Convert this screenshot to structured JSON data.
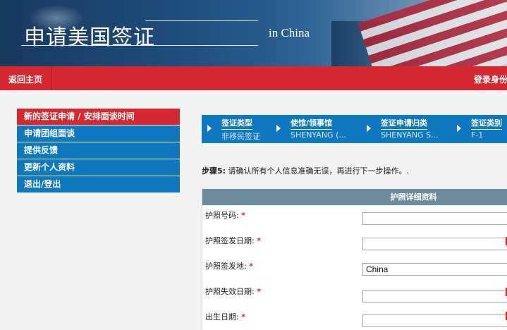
{
  "header": {
    "title": "申请美国签证",
    "subtitle": "in China"
  },
  "navbar": {
    "home": "返回主页",
    "login": "登录身份"
  },
  "menu": {
    "items": [
      {
        "label": "新的签证申请 / 安排面谈时间"
      },
      {
        "label": "申请团组面谈"
      },
      {
        "label": "提供反馈"
      },
      {
        "label": "更新个人资料"
      },
      {
        "label": "退出/登出"
      }
    ]
  },
  "steps": [
    {
      "label": "签证类型",
      "value": "非移民签证"
    },
    {
      "label": "使馆/领事馆",
      "value": "SHENYANG (..."
    },
    {
      "label": "签证申请归类",
      "value": "SHENYANG S..."
    },
    {
      "label": "签证类别",
      "value": "F-1"
    }
  ],
  "instruction": {
    "step": "步骤5:",
    "text": " 请确认所有个人信息准确无误，再进行下一步操作。."
  },
  "form": {
    "header": "护照详细资料",
    "required_mark": "*",
    "fields": [
      {
        "label": "护照号码:",
        "value": ""
      },
      {
        "label": "护照签发日期:",
        "value": ""
      },
      {
        "label": "护照签发地:",
        "value": "China"
      },
      {
        "label": "护照失效日期:",
        "value": ""
      },
      {
        "label": "出生日期:",
        "value": ""
      }
    ]
  },
  "colors": {
    "brand_red": "#d7282f",
    "brand_blue": "#0e78c0",
    "form_header": "#6a8c9e"
  }
}
